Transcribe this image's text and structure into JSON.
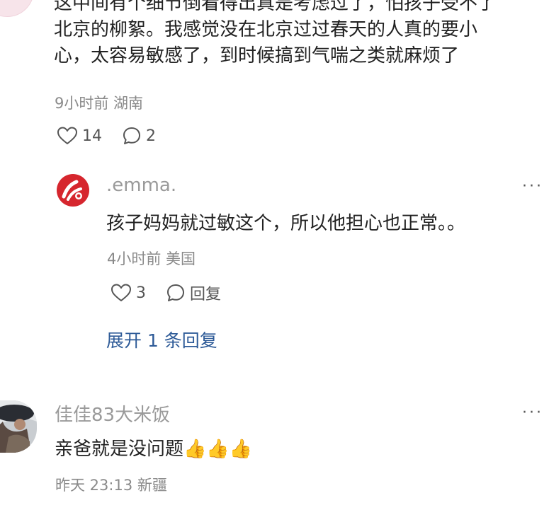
{
  "comment_1": {
    "text_lines": [
      "这中间有个细节倒看得出真是考虑过了，怕孩子受不了",
      "北京的柳絮。我感觉没在北京过过春天的人真的要小",
      "心，太容易敏感了，到时候搞到气喘之类就麻烦了"
    ],
    "meta": "9小时前 湖南",
    "likes": "14",
    "replies": "2"
  },
  "reply_1": {
    "username": ".emma.",
    "more": "···",
    "text": "孩子妈妈就过敏这个，所以他担心也正常。。",
    "meta": "4小时前 美国",
    "likes": "3",
    "reply_label": "回复",
    "expand_label": "展开 1 条回复"
  },
  "comment_2": {
    "username": "佳佳83大米饭",
    "more": "···",
    "text": "亲爸就是没问题👍👍👍",
    "meta": "昨天 23:13 新疆"
  },
  "icons": {
    "like": "heart-outline-icon",
    "comment": "speech-bubble-icon",
    "more": "ellipsis-icon"
  },
  "colors": {
    "link": "#2d5a97",
    "meta": "#8a8a8a",
    "avatar_red": "#d6262e"
  }
}
